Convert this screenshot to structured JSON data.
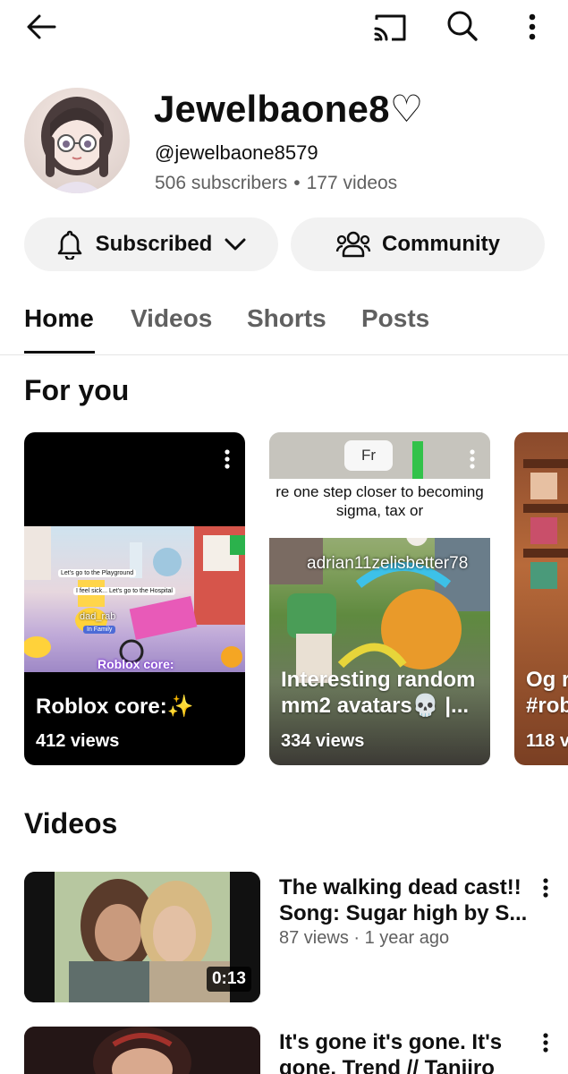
{
  "topbar": {
    "back_icon": "arrow-left-icon",
    "cast_icon": "cast-icon",
    "search_icon": "search-icon",
    "more_icon": "more-vertical-icon"
  },
  "channel": {
    "name": "Jewelbaone8♡",
    "handle": "@jewelbaone8579",
    "subscribers": "506 subscribers",
    "videos_count": "177 videos",
    "separator": "•"
  },
  "actions": {
    "subscribed_label": "Subscribed",
    "community_label": "Community"
  },
  "tabs": [
    {
      "label": "Home",
      "active": true
    },
    {
      "label": "Videos",
      "active": false
    },
    {
      "label": "Shorts",
      "active": false
    },
    {
      "label": "Posts",
      "active": false
    }
  ],
  "for_you": {
    "title": "For you",
    "cards": [
      {
        "title": "Roblox core:✨",
        "views": "412 views"
      },
      {
        "title_line1": "Interesting random",
        "title_line2": "mm2 avatars💀 |...",
        "views": "334 views",
        "badge": "Fr",
        "caption_line1": "re one step closer to becoming",
        "caption_line2": "sigma, tax or",
        "overlay_text": "adrian11zelisbetter78"
      },
      {
        "title_line1": "Og r",
        "title_line2": "#rob",
        "views": "118 v"
      }
    ]
  },
  "roblox_overlay": {
    "bubble1": "Let's go to the Playground",
    "bubble2": "I feel sick... Let's go to the Hospital",
    "name1": "dad_rab",
    "name2": "In Family",
    "watermark": "Roblox core:"
  },
  "videos_section": {
    "title": "Videos",
    "items": [
      {
        "title": "The walking dead cast!! Song: Sugar high by S...",
        "views": "87 views",
        "age": "1 year ago",
        "duration": "0:13"
      },
      {
        "title": "It's gone it's gone. It's gone. Trend // Tanjiro",
        "views": "",
        "age": "",
        "duration": ""
      }
    ],
    "meta_separator": "·"
  }
}
